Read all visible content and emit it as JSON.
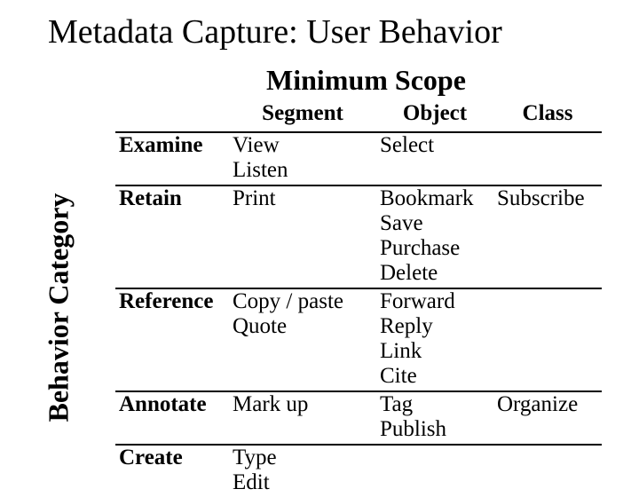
{
  "title": "Metadata Capture: User Behavior",
  "axes": {
    "top": "Minimum Scope",
    "side": "Behavior Category"
  },
  "columns": {
    "segment": "Segment",
    "object": "Object",
    "class": "Class"
  },
  "rows": [
    {
      "label": "Examine",
      "segment": "View\nListen",
      "object": "Select",
      "class": ""
    },
    {
      "label": "Retain",
      "segment": "Print",
      "object": "Bookmark\nSave\nPurchase\nDelete",
      "class": "Subscribe"
    },
    {
      "label": "Reference",
      "segment": "Copy / paste\nQuote",
      "object": "Forward\nReply\nLink\nCite",
      "class": ""
    },
    {
      "label": "Annotate",
      "segment": "Mark up",
      "object": "Tag\nPublish",
      "class": "Organize"
    },
    {
      "label": "Create",
      "segment": "Type\nEdit",
      "object": "",
      "class": ""
    }
  ],
  "chart_data": {
    "type": "table",
    "title": "Metadata Capture: User Behavior",
    "x_axis_label": "Minimum Scope",
    "y_axis_label": "Behavior Category",
    "columns": [
      "Segment",
      "Object",
      "Class"
    ],
    "rows": [
      "Examine",
      "Retain",
      "Reference",
      "Annotate",
      "Create"
    ],
    "cells": {
      "Examine": {
        "Segment": [
          "View",
          "Listen"
        ],
        "Object": [
          "Select"
        ],
        "Class": []
      },
      "Retain": {
        "Segment": [
          "Print"
        ],
        "Object": [
          "Bookmark",
          "Save",
          "Purchase",
          "Delete"
        ],
        "Class": [
          "Subscribe"
        ]
      },
      "Reference": {
        "Segment": [
          "Copy / paste",
          "Quote"
        ],
        "Object": [
          "Forward",
          "Reply",
          "Link",
          "Cite"
        ],
        "Class": []
      },
      "Annotate": {
        "Segment": [
          "Mark up"
        ],
        "Object": [
          "Tag",
          "Publish"
        ],
        "Class": [
          "Organize"
        ]
      },
      "Create": {
        "Segment": [
          "Type",
          "Edit"
        ],
        "Object": [],
        "Class": []
      }
    }
  }
}
